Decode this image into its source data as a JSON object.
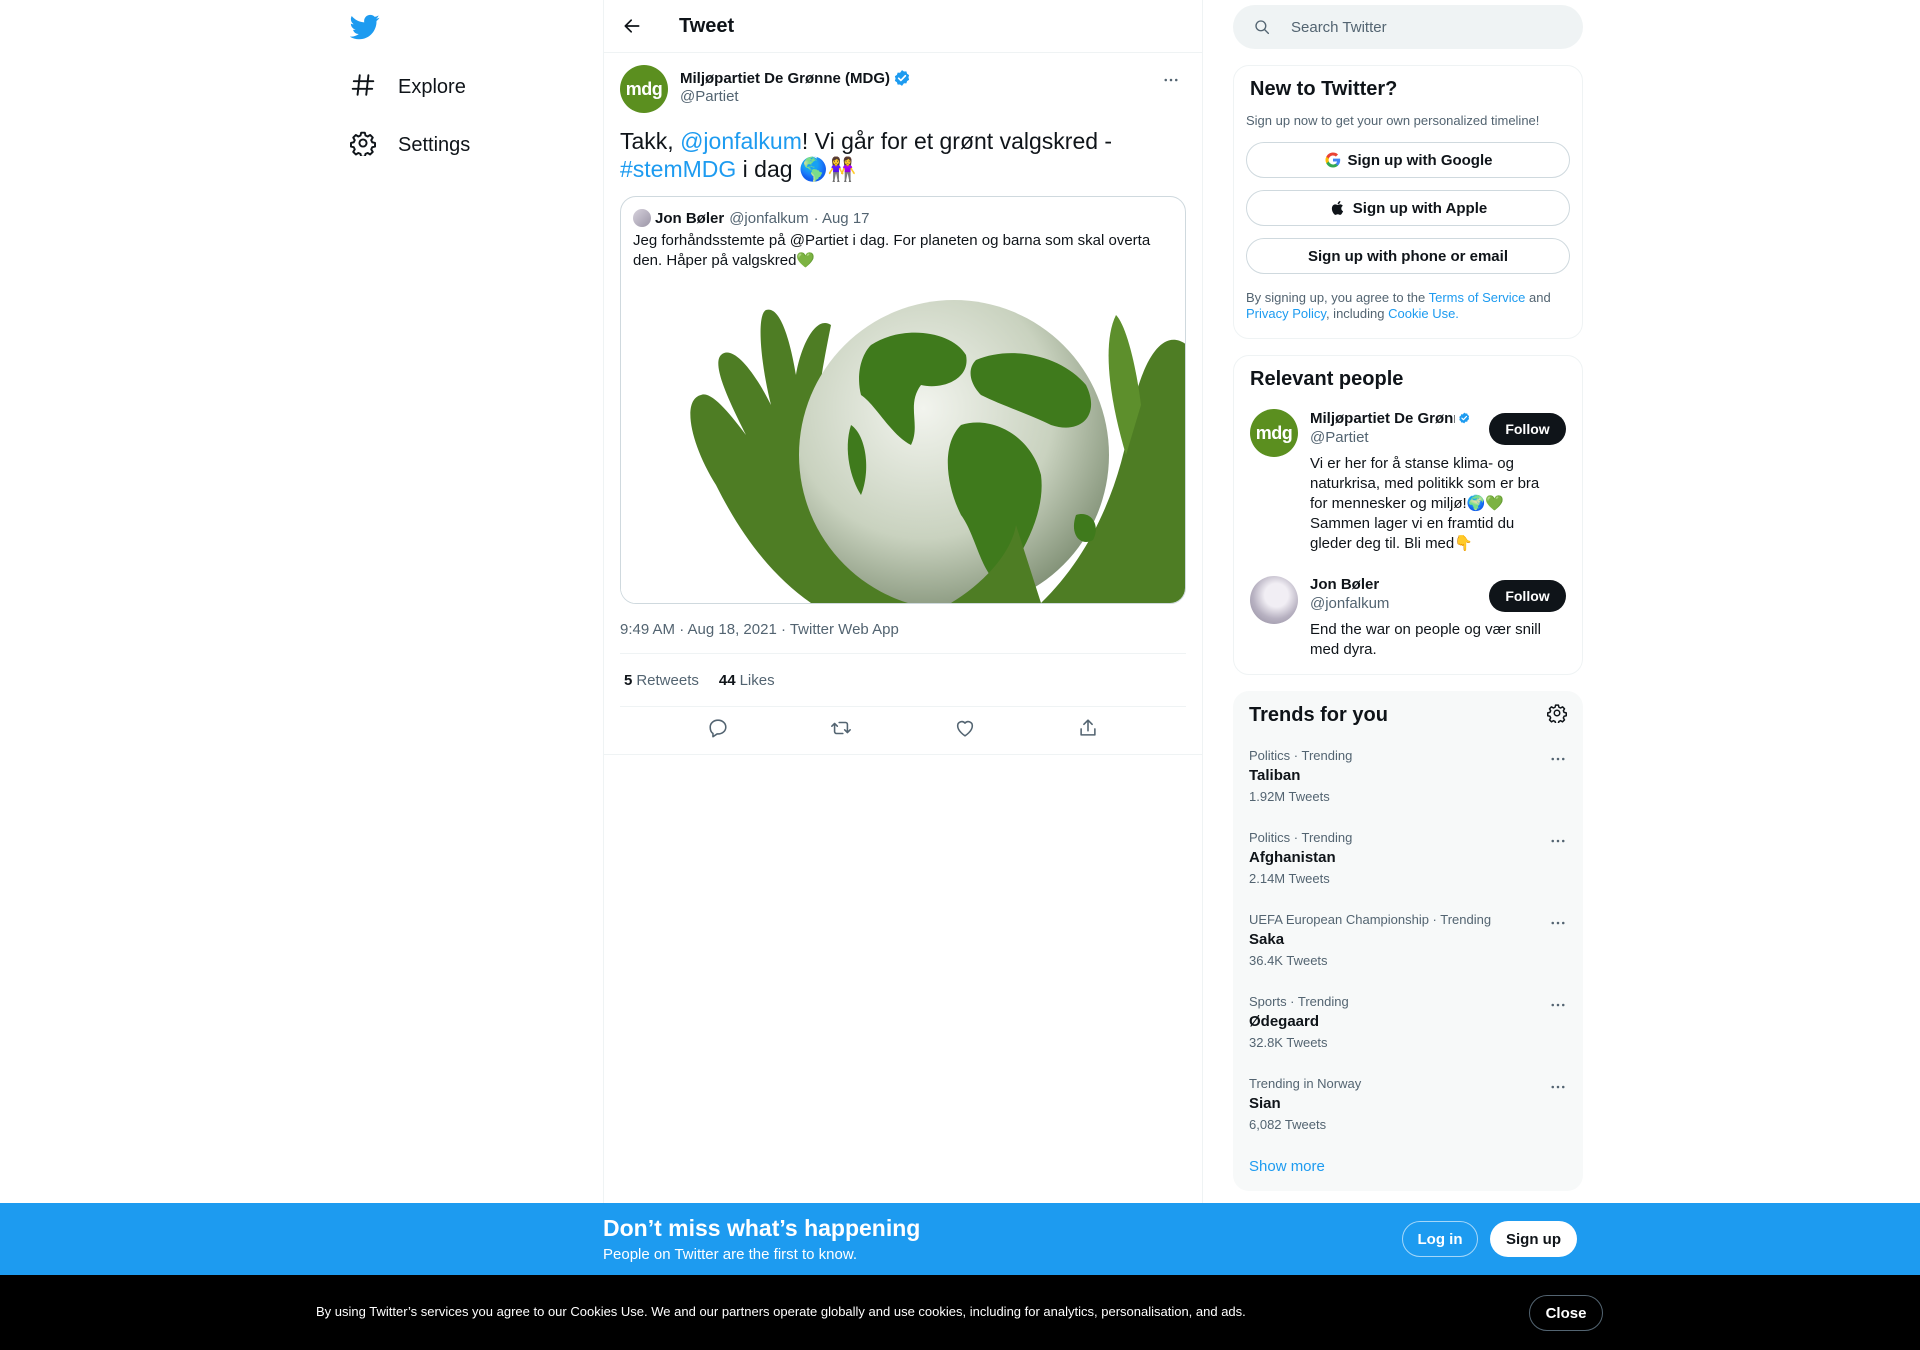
{
  "nav": {
    "explore_label": "Explore",
    "settings_label": "Settings"
  },
  "header": {
    "title": "Tweet"
  },
  "tweet": {
    "author_name": "Miljøpartiet De Grønne (MDG)",
    "author_handle": "@Partiet",
    "avatar_text": "mdg",
    "text_prefix": "Takk, ",
    "mention": "@jonfalkum",
    "text_middle": "! Vi går for et grønt valgskred -",
    "hashtag": "#stemMDG",
    "text_suffix": " i dag 🌎👭",
    "timestamp": "9:49 AM · Aug 18, 2021 · Twitter Web App",
    "retweets_count": "5",
    "retweets_label": "Retweets",
    "likes_count": "44",
    "likes_label": "Likes"
  },
  "quote": {
    "author_name": "Jon Bøler",
    "author_handle": "@jonfalkum",
    "date": "· Aug 17",
    "text": "Jeg forhåndsstemte på @Partiet i dag. For planeten og barna som skal overta den. Håper på valgskred💚"
  },
  "search": {
    "placeholder": "Search Twitter"
  },
  "new_to_twitter": {
    "title": "New to Twitter?",
    "subtitle": "Sign up now to get your own personalized timeline!",
    "google_label": "Sign up with Google",
    "apple_label": "Sign up with Apple",
    "phone_label": "Sign up with phone or email",
    "legal_1": "By signing up, you agree to the ",
    "tos": "Terms of Service",
    "legal_2": " and ",
    "privacy": "Privacy Policy",
    "legal_3": ", including ",
    "cookie": "Cookie Use."
  },
  "relevant": {
    "title": "Relevant people",
    "people": [
      {
        "name": "Miljøpartiet De Grønne (MDG)",
        "handle": "@Partiet",
        "avatar_text": "mdg",
        "bio": "Vi er her for å stanse klima- og naturkrisa, med politikk som er bra for mennesker og miljø!🌍💚 Sammen lager vi en framtid du gleder deg til. Bli med👇",
        "follow_label": "Follow"
      },
      {
        "name": "Jon Bøler",
        "handle": "@jonfalkum",
        "bio": "End the war on people og vær snill med dyra.",
        "follow_label": "Follow"
      }
    ]
  },
  "trends": {
    "title": "Trends for you",
    "items": [
      {
        "context": "Politics · Trending",
        "name": "Taliban",
        "count": "1.92M Tweets"
      },
      {
        "context": "Politics · Trending",
        "name": "Afghanistan",
        "count": "2.14M Tweets"
      },
      {
        "context": "UEFA European Championship · Trending",
        "name": "Saka",
        "count": "36.4K Tweets"
      },
      {
        "context": "Sports · Trending",
        "name": "Ødegaard",
        "count": "32.8K Tweets"
      },
      {
        "context": "Trending in Norway",
        "name": "Sian",
        "count": "6,082 Tweets"
      }
    ],
    "show_more": "Show more"
  },
  "signup_bar": {
    "title": "Don’t miss what’s happening",
    "subtitle": "People on Twitter are the first to know.",
    "login_label": "Log in",
    "signup_label": "Sign up"
  },
  "cookie_bar": {
    "text": "By using Twitter’s services you agree to our Cookies Use. We and our partners operate globally and use cookies, including for analytics, personalisation, and ads.",
    "close_label": "Close"
  },
  "colors": {
    "accent": "#1d9bf0",
    "mdg_green": "#5b8f1f",
    "text": "#0f1419",
    "muted": "#536471"
  }
}
